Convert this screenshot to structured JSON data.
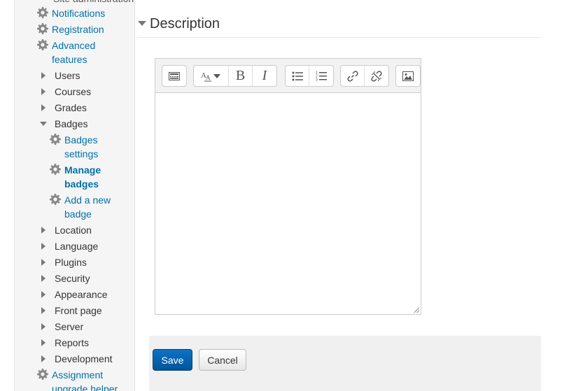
{
  "sidebar": {
    "top_partial": "Site administration",
    "notifications": "Notifications",
    "registration": "Registration",
    "advanced_1": "Advanced",
    "advanced_2": "features",
    "users": "Users",
    "courses": "Courses",
    "grades": "Grades",
    "badges": "Badges",
    "badges_settings_1": "Badges",
    "badges_settings_2": "settings",
    "manage_badges_1": "Manage",
    "manage_badges_2": "badges",
    "add_badge_1": "Add a new",
    "add_badge_2": "badge",
    "location": "Location",
    "language": "Language",
    "plugins": "Plugins",
    "security": "Security",
    "appearance": "Appearance",
    "front_page": "Front page",
    "server": "Server",
    "reports": "Reports",
    "development": "Development",
    "assignment_1": "Assignment",
    "assignment_2": "upgrade helper"
  },
  "main": {
    "section_title": "Description",
    "save_label": "Save",
    "cancel_label": "Cancel"
  },
  "colors": {
    "link": "#0070a8",
    "primary_button": "#045399"
  }
}
